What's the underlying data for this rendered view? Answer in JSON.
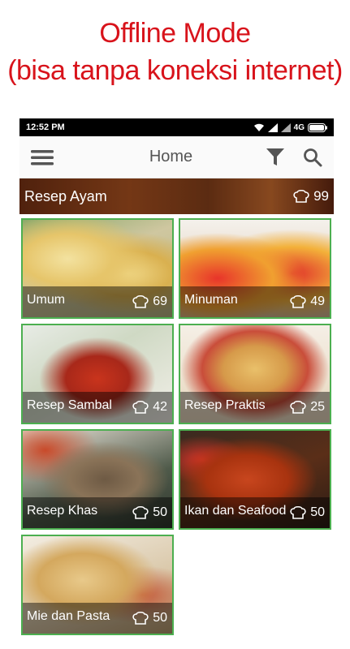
{
  "promo": {
    "line1": "Offline Mode",
    "line2": "(bisa tanpa koneksi internet)"
  },
  "status": {
    "time": "12:52 PM",
    "network": "4G"
  },
  "appbar": {
    "title": "Home",
    "menu_icon": "menu-icon",
    "filter_icon": "filter-icon",
    "search_icon": "search-icon"
  },
  "banner": {
    "label": "Resep Ayam",
    "count": "99"
  },
  "categories": [
    {
      "name": "Umum",
      "count": "69"
    },
    {
      "name": "Minuman",
      "count": "49"
    },
    {
      "name": "Resep Sambal",
      "count": "42"
    },
    {
      "name": "Resep Praktis",
      "count": "25"
    },
    {
      "name": "Resep Khas",
      "count": "50"
    },
    {
      "name": "Ikan dan Seafood",
      "count": "50"
    },
    {
      "name": "Mie dan Pasta",
      "count": "50"
    }
  ],
  "colors": {
    "promo_text": "#d8131b",
    "card_border": "#4caf50"
  }
}
